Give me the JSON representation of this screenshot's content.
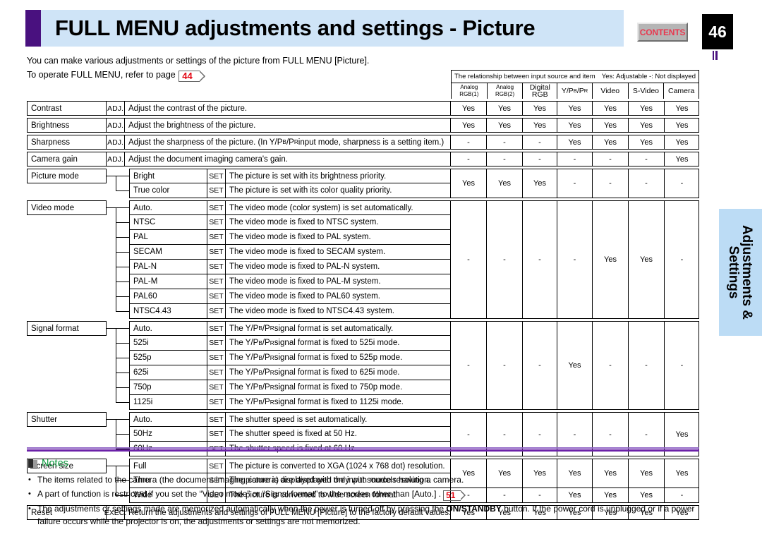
{
  "header": {
    "title": "FULL MENU adjustments and settings - Picture",
    "contents_button": "CONTENTS",
    "page_number": "46"
  },
  "intro": {
    "line1": "You can make various adjustments or settings of the picture from FULL MENU [Picture].",
    "line2_before": "To operate FULL MENU, refer to page",
    "page_link": "44",
    "line2_after": "."
  },
  "side_tab": {
    "line1": "Adjustments &",
    "line2": "Settings"
  },
  "matrix_header": {
    "caption": "The relationship between input source and item",
    "legend": "Yes: Adjustable   -: Not displayed",
    "columns": [
      "Analog RGB(1)",
      "Analog RGB(2)",
      "Digital RGB",
      "Y/PB/PR",
      "Video",
      "S-Video",
      "Camera"
    ]
  },
  "table": {
    "groups": [
      {
        "type": "simple",
        "name": "Contrast",
        "action": "ADJ.",
        "description": "Adjust the contrast of the picture.",
        "values": [
          [
            "Yes",
            "Yes",
            "Yes",
            "Yes",
            "Yes",
            "Yes",
            "Yes"
          ]
        ]
      },
      {
        "type": "simple",
        "name": "Brightness",
        "action": "ADJ.",
        "description": "Adjust the brightness of the picture.",
        "values": [
          [
            "Yes",
            "Yes",
            "Yes",
            "Yes",
            "Yes",
            "Yes",
            "Yes"
          ]
        ]
      },
      {
        "type": "simple",
        "name": "Sharpness",
        "action": "ADJ.",
        "description": "Adjust the sharpness of the picture. (In Y/PB/PR input mode, sharpness is a setting item.)",
        "values": [
          [
            "-",
            "-",
            "-",
            "Yes",
            "Yes",
            "Yes",
            "Yes"
          ]
        ]
      },
      {
        "type": "simple",
        "name": "Camera gain",
        "action": "ADJ.",
        "description": "Adjust the document imaging camera's gain.",
        "values": [
          [
            "-",
            "-",
            "-",
            "-",
            "-",
            "-",
            "Yes"
          ]
        ]
      },
      {
        "type": "group",
        "name": "Picture mode",
        "rows": [
          {
            "label": "Bright",
            "action": "SET",
            "description": "The picture is set with its brightness priority."
          },
          {
            "label": "True color",
            "action": "SET",
            "description": "The picture is set with its color quality priority."
          }
        ],
        "values": [
          [
            "Yes",
            "Yes",
            "Yes",
            "-",
            "-",
            "-",
            "-"
          ]
        ]
      },
      {
        "type": "group",
        "name": "Video mode",
        "rows": [
          {
            "label": "Auto.",
            "action": "SET",
            "description": "The video mode (color system) is set automatically."
          },
          {
            "label": "NTSC",
            "action": "SET",
            "description": "The video mode is fixed to NTSC system."
          },
          {
            "label": "PAL",
            "action": "SET",
            "description": "The video mode is fixed to PAL system."
          },
          {
            "label": "SECAM",
            "action": "SET",
            "description": "The video mode is fixed to SECAM system."
          },
          {
            "label": "PAL-N",
            "action": "SET",
            "description": "The video mode is fixed to PAL-N system."
          },
          {
            "label": "PAL-M",
            "action": "SET",
            "description": "The video mode is fixed to PAL-M system."
          },
          {
            "label": "PAL60",
            "action": "SET",
            "description": "The video mode is fixed to PAL60 system."
          },
          {
            "label": "NTSC4.43",
            "action": "SET",
            "description": "The video mode is fixed to NTSC4.43 system."
          }
        ],
        "values": [
          [
            "-",
            "-",
            "-",
            "-",
            "Yes",
            "Yes",
            "-"
          ]
        ]
      },
      {
        "type": "group",
        "name": "Signal format",
        "rows": [
          {
            "label": "Auto.",
            "action": "SET",
            "description": "The Y/PB/PR signal format is set automatically."
          },
          {
            "label": "525i",
            "action": "SET",
            "description": "The Y/PB/PR signal format is fixed to 525i mode."
          },
          {
            "label": "525p",
            "action": "SET",
            "description": "The Y/PB/PR signal format is fixed to 525p mode."
          },
          {
            "label": "625i",
            "action": "SET",
            "description": "The Y/PB/PR signal format is fixed to 625i mode."
          },
          {
            "label": "750p",
            "action": "SET",
            "description": "The Y/PB/PR signal format is fixed to 750p mode."
          },
          {
            "label": "1125i",
            "action": "SET",
            "description": "The Y/PB/PR signal format is fixed to 1125i mode."
          }
        ],
        "values": [
          [
            "-",
            "-",
            "-",
            "Yes",
            "-",
            "-",
            "-"
          ]
        ]
      },
      {
        "type": "group",
        "name": "Shutter",
        "rows": [
          {
            "label": "Auto.",
            "action": "SET",
            "description": "The shutter speed is set automatically."
          },
          {
            "label": "50Hz",
            "action": "SET",
            "description": "The shutter speed is fixed at 50 Hz."
          },
          {
            "label": "60Hz",
            "action": "SET",
            "description": "The shutter speed is fixed at 60 Hz."
          }
        ],
        "values": [
          [
            "-",
            "-",
            "-",
            "-",
            "-",
            "-",
            "Yes"
          ]
        ]
      },
      {
        "type": "group",
        "name": "Screen size",
        "rows": [
          {
            "label": "Full",
            "action": "SET",
            "description": "The picture is converted to XGA (1024 x 768 dot) resolution."
          },
          {
            "label": "Thru",
            "action": "SET",
            "description": "The picture is displayed with the input source resolution."
          },
          {
            "label": "Wide",
            "action": "SET",
            "description": "The picture is converted to wide screen format."
          }
        ],
        "values": [
          [
            "Yes",
            "Yes",
            "Yes",
            "Yes",
            "Yes",
            "Yes",
            "Yes"
          ],
          [
            "-",
            "-",
            "-",
            "Yes",
            "Yes",
            "Yes",
            "-"
          ]
        ],
        "value_spans": [
          2,
          1
        ]
      },
      {
        "type": "simple",
        "name": "Reset",
        "action": "EXEC.",
        "description": "Return the adjustments and settings of FULL MENU [Picture] to the factory default values.",
        "values": [
          [
            "Yes",
            "Yes",
            "Yes",
            "Yes",
            "Yes",
            "Yes",
            "Yes"
          ]
        ]
      }
    ]
  },
  "notes": {
    "title": "Notes",
    "items": [
      {
        "text": "The items related to the camera (the document imaging camera) are displayed only with models having a camera."
      },
      {
        "text_before": "A part of function is restricted if you set the “Video mode” or “Signal format” to the modes other than [Auto.] .",
        "page_link": "51"
      },
      {
        "text_before": "The adjustments or settings made are memorized automatically when the power is turned off by pressing the ",
        "bold": "ON/STANDBY",
        "text_after": " button. If the power cord is unplugged or if a power failure occurs while the projector is on, the adjustments or settings are not memorized."
      }
    ]
  }
}
